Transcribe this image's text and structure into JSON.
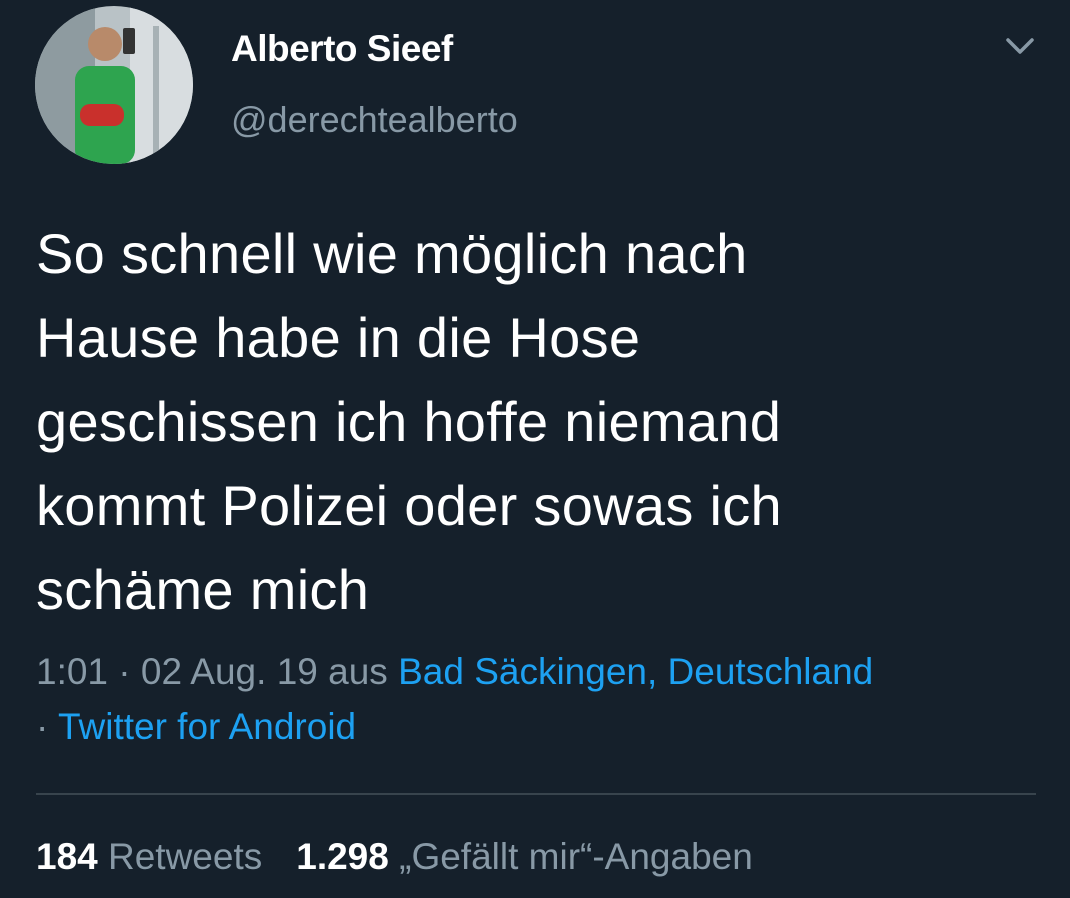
{
  "user": {
    "name": "Alberto Sieef",
    "handle": "@derechtealberto",
    "avatar_icon": "profile-photo"
  },
  "menu": {
    "icon": "chevron-down-icon"
  },
  "tweet": {
    "lines": [
      "So schnell wie möglich nach",
      "Hause habe in die Hose",
      "geschissen ich hoffe niemand",
      "kommt Polizei oder sowas ich",
      "schäme mich"
    ]
  },
  "meta": {
    "time": "1:01",
    "separator1": " · ",
    "date": "02 Aug. 19",
    "from": " aus ",
    "location": "Bad Säckingen, Deutschland",
    "separator2": "· ",
    "source": "Twitter for Android"
  },
  "stats": {
    "retweets_count": "184",
    "retweets_label": " Retweets",
    "likes_count": "1.298",
    "likes_label": " „Gefällt mir“-Angaben"
  },
  "colors": {
    "background": "#15202b",
    "text": "#ffffff",
    "secondary": "#8899a6",
    "link": "#1da1f2",
    "divider": "#38444d"
  }
}
